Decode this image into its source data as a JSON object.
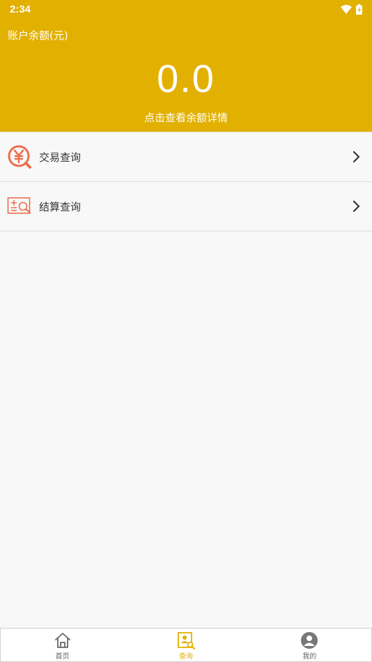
{
  "status_bar": {
    "time": "2:34"
  },
  "header": {
    "balance_label": "账户余额(元)",
    "balance_value": "0.0",
    "detail_link": "点击查看余额详情"
  },
  "menu": {
    "items": [
      {
        "label": "交易查询",
        "icon": "yuan-search-icon"
      },
      {
        "label": "结算查询",
        "icon": "settlement-search-icon"
      }
    ]
  },
  "tabbar": {
    "tabs": [
      {
        "label": "首页",
        "icon": "home-icon"
      },
      {
        "label": "查询",
        "icon": "query-icon",
        "active": true
      },
      {
        "label": "我的",
        "icon": "profile-icon"
      }
    ]
  },
  "colors": {
    "accent": "#e2b000",
    "menu_icon": "#ee6c4d",
    "tab_inactive": "#666666"
  }
}
